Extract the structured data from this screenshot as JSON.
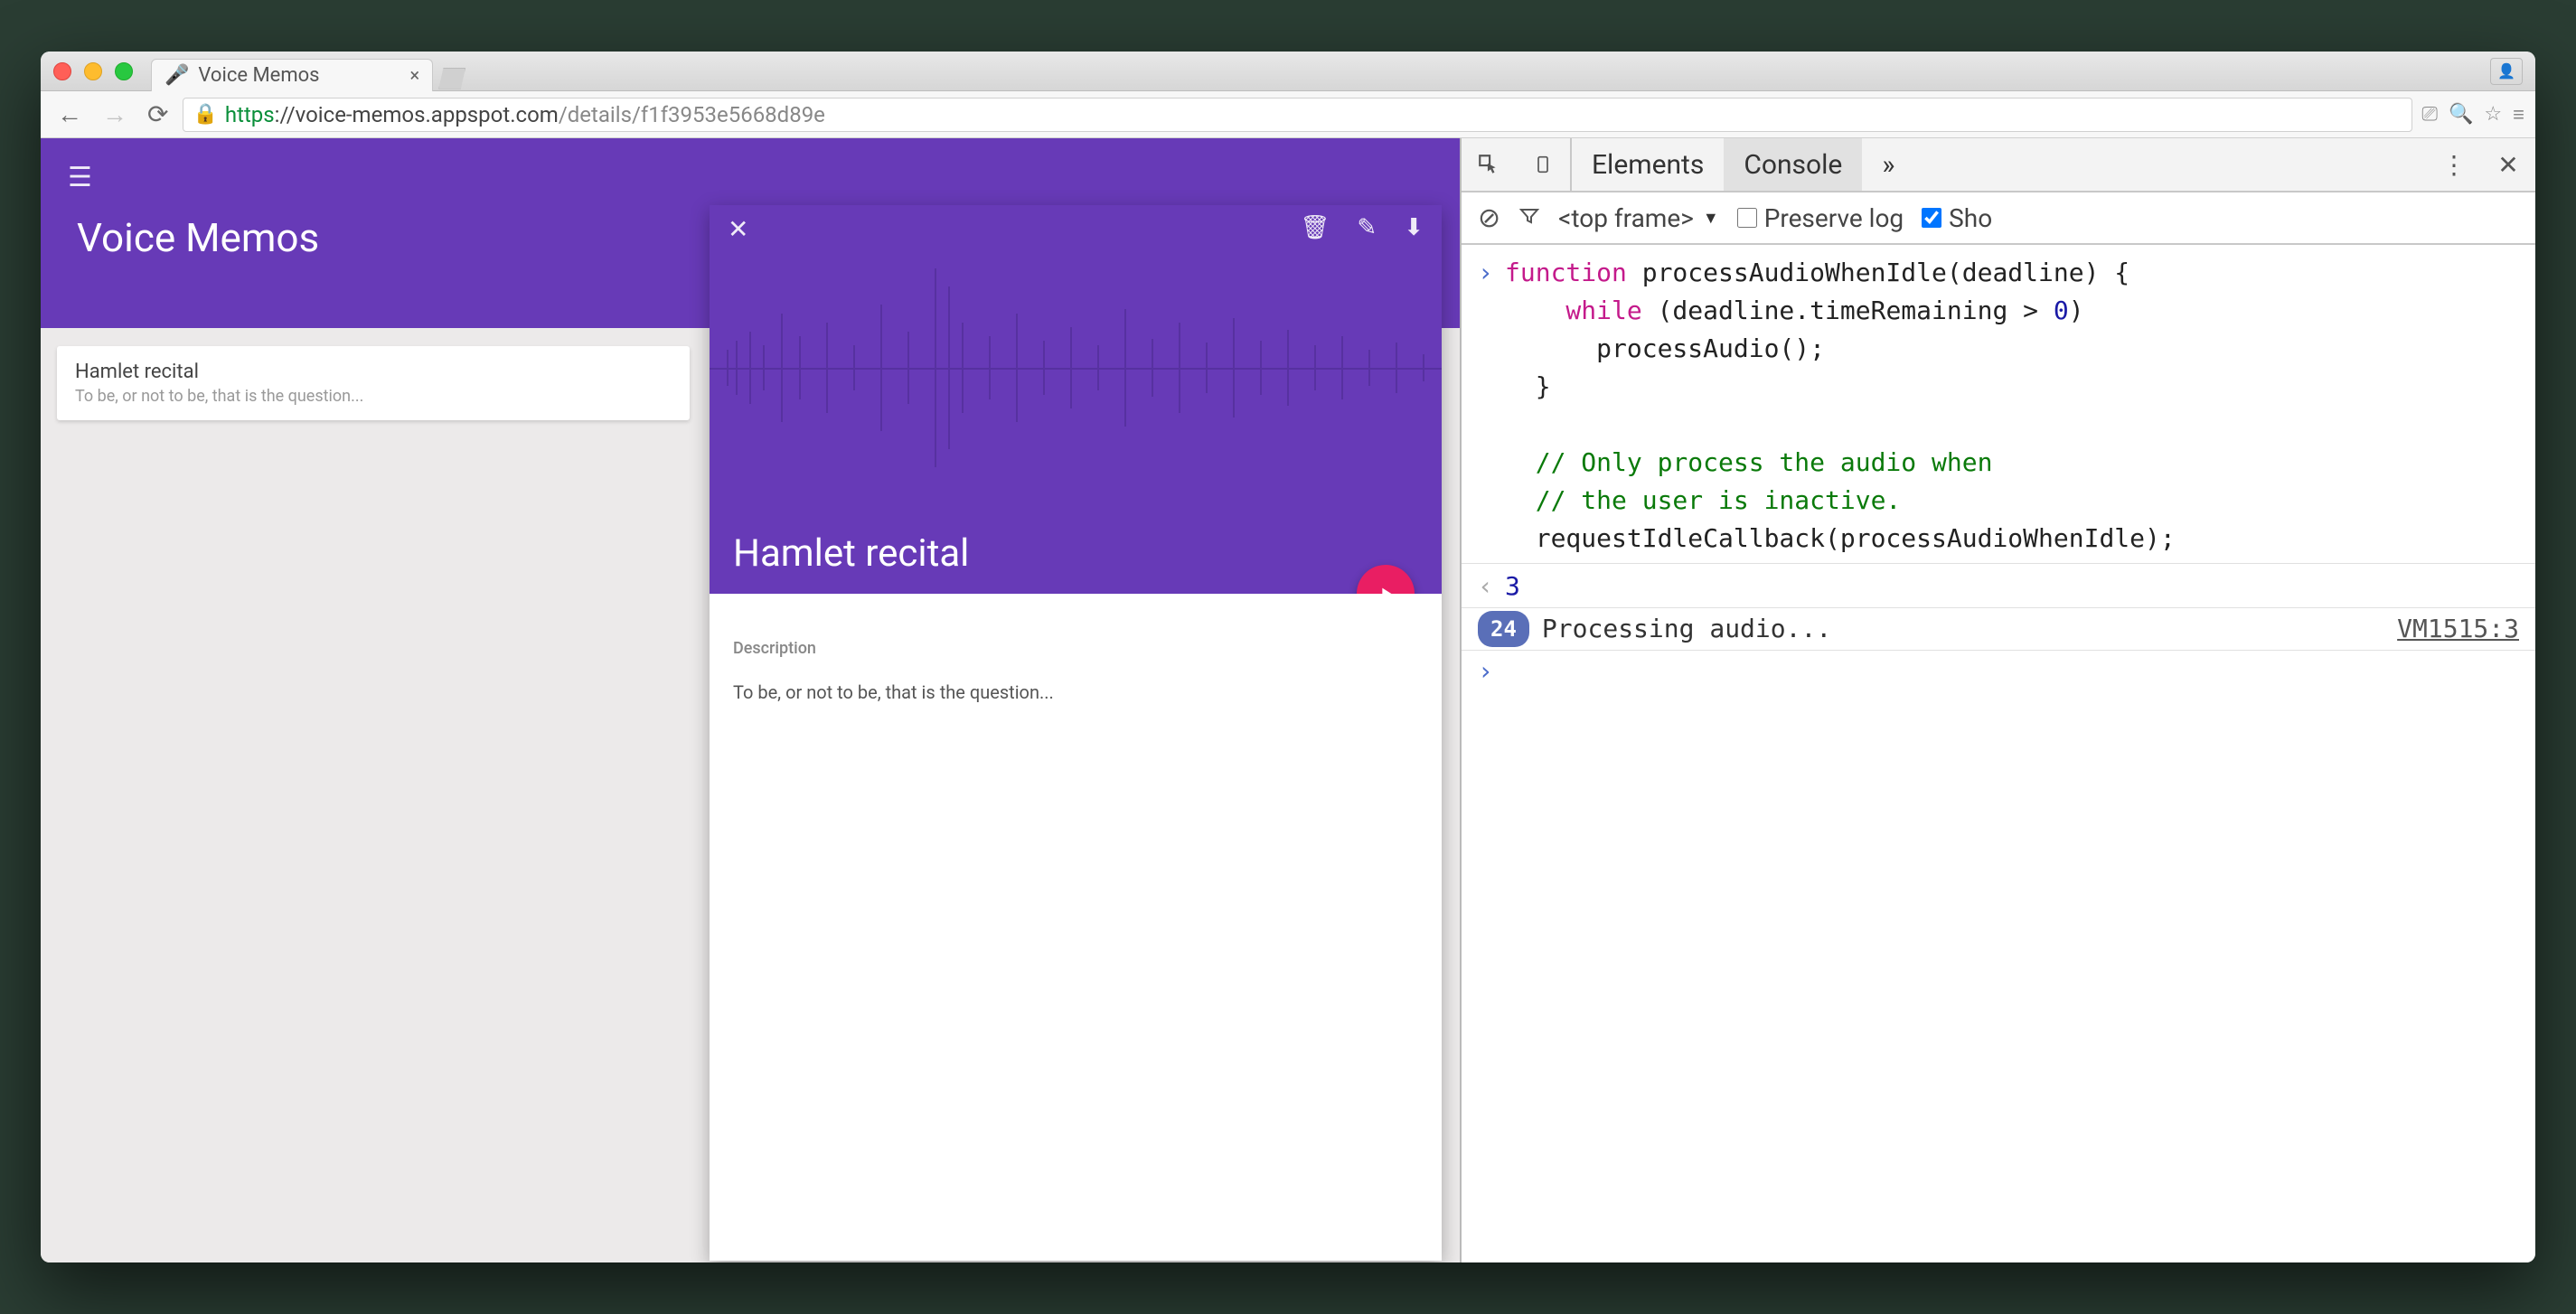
{
  "browser": {
    "tab_title": "Voice Memos",
    "url_proto": "https",
    "url_host": "://voice-memos.appspot.com",
    "url_path": "/details/f1f3953e5668d89e"
  },
  "app": {
    "title": "Voice Memos",
    "list_item": {
      "title": "Hamlet recital",
      "subtitle": "To be, or not to be, that is the question..."
    },
    "detail": {
      "title": "Hamlet recital",
      "desc_label": "Description",
      "desc_text": "To be, or not to be, that is the question..."
    }
  },
  "devtools": {
    "tabs": {
      "elements": "Elements",
      "console": "Console",
      "more_glyph": "»"
    },
    "filter": {
      "frame_label": "<top frame>",
      "preserve_label": "Preserve log",
      "show_label": "Sho",
      "preserve_checked": false,
      "show_checked": true
    },
    "code": {
      "l1a": "function",
      "l1b": " processAudioWhenIdle(deadline) {",
      "l2a": "    while",
      "l2b": " (deadline.timeRemaining > ",
      "l2c": "0",
      "l2d": ")",
      "l3": "      processAudio();",
      "l4": "  }",
      "c1": "  // Only process the audio when",
      "c2": "  // the user is inactive.",
      "l5": "  requestIdleCallback(processAudioWhenIdle);"
    },
    "return_value": "3",
    "log": {
      "count": "24",
      "msg": "Processing audio...",
      "src": "VM1515:3"
    }
  }
}
